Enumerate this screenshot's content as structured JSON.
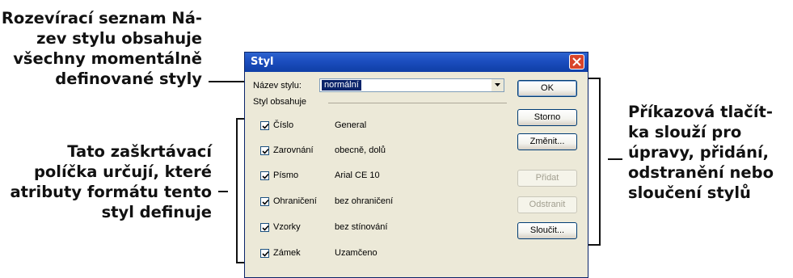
{
  "callouts": {
    "left_top": [
      "Rozevírací seznam Ná-",
      "zev stylu obsahuje",
      "všechny momentálně",
      "definované styly"
    ],
    "left_mid": [
      "Tato zaškrtávací",
      "políčka určují, které",
      "atributy formátu tento",
      "styl definuje"
    ],
    "right": [
      "Příkazová tlačít-",
      "ka slouží pro",
      "úpravy, přidání,",
      "odstranění nebo",
      "sloučení stylů"
    ]
  },
  "dialog": {
    "title": "Styl",
    "name_label": "Název stylu:",
    "selected_style": "normální",
    "group_label": "Styl obsahuje",
    "attributes": [
      {
        "label": "Číslo",
        "value": "General",
        "checked": true
      },
      {
        "label": "Zarovnání",
        "value": "obecně, dolů",
        "checked": true
      },
      {
        "label": "Písmo",
        "value": "Arial CE 10",
        "checked": true
      },
      {
        "label": "Ohraničení",
        "value": "bez ohraničení",
        "checked": true
      },
      {
        "label": "Vzorky",
        "value": "bez stínování",
        "checked": true
      },
      {
        "label": "Zámek",
        "value": "Uzamčeno",
        "checked": true
      }
    ],
    "buttons": {
      "ok": "OK",
      "cancel": "Storno",
      "modify": "Změnit...",
      "add": "Přidat",
      "delete": "Odstranit",
      "merge": "Sloučit..."
    }
  },
  "colors": {
    "titlebar": "#0f3ea6",
    "dialog_bg": "#ece9d8",
    "close": "#d8442a"
  }
}
